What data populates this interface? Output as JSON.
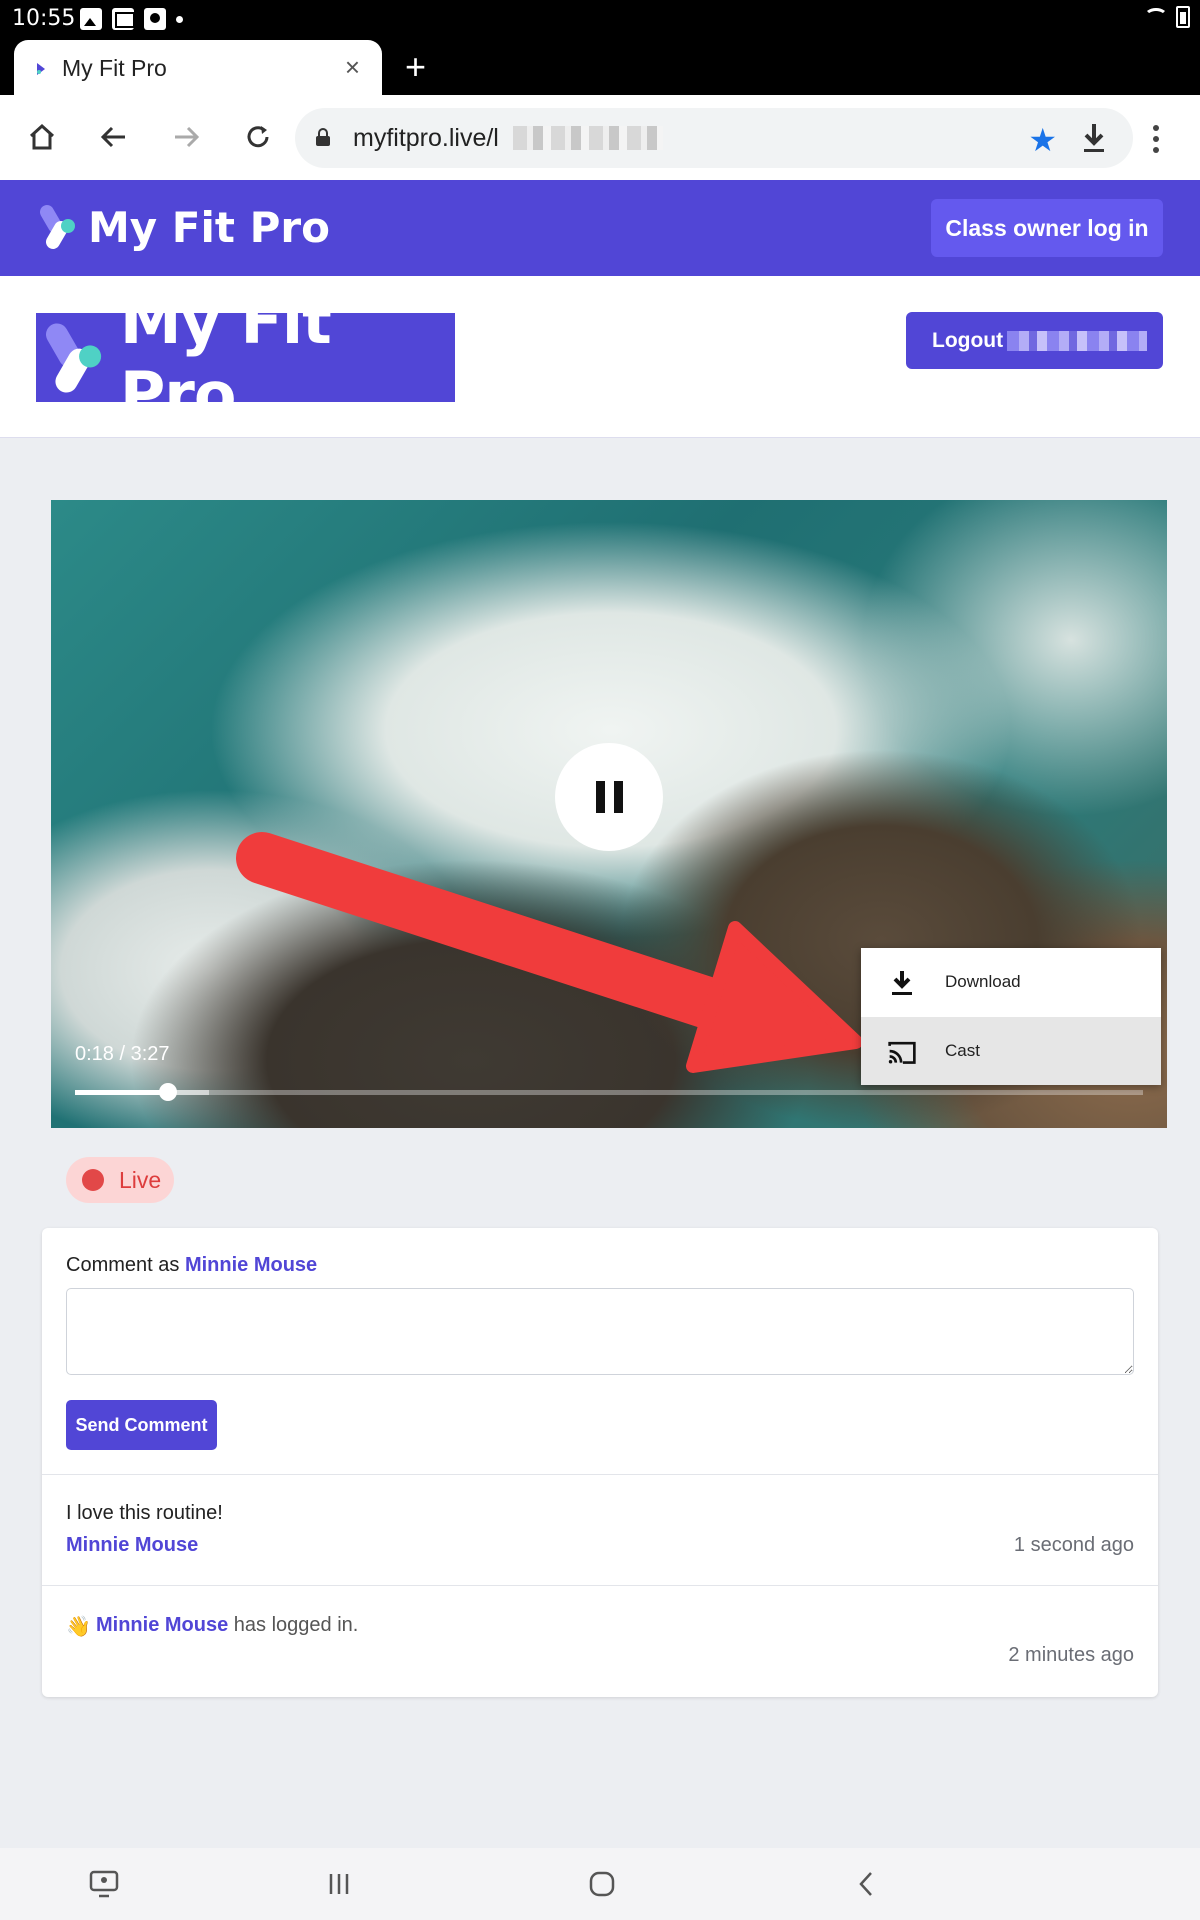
{
  "status_bar": {
    "time": "10:55"
  },
  "browser": {
    "tab_title": "My Fit Pro",
    "tab_close": "×",
    "new_tab": "+",
    "url": "myfitpro.live/l"
  },
  "header": {
    "logo_text": "My Fit Pro",
    "class_owner_login": "Class owner log in"
  },
  "page": {
    "logo_text": "My Fit Pro",
    "logout_label": "Logout"
  },
  "video": {
    "time_display": "0:18 / 3:27",
    "progress": {
      "current_seconds": 18,
      "duration_seconds": 207,
      "buffered_fraction": 0.125
    },
    "menu": {
      "download_label": "Download",
      "cast_label": "Cast"
    }
  },
  "live": {
    "label": "Live"
  },
  "comments": {
    "comment_as_prefix": "Comment as",
    "current_user": "Minnie Mouse",
    "send_label": "Send Comment",
    "items": [
      {
        "text": "I love this routine!",
        "user": "Minnie Mouse",
        "time": "1 second ago"
      }
    ],
    "login_event": {
      "emoji": "👋",
      "user": "Minnie Mouse",
      "suffix": "has logged in.",
      "time": "2 minutes ago"
    }
  },
  "colors": {
    "brand": "#5146d6",
    "live": "#e24848",
    "star": "#1a73e8"
  }
}
